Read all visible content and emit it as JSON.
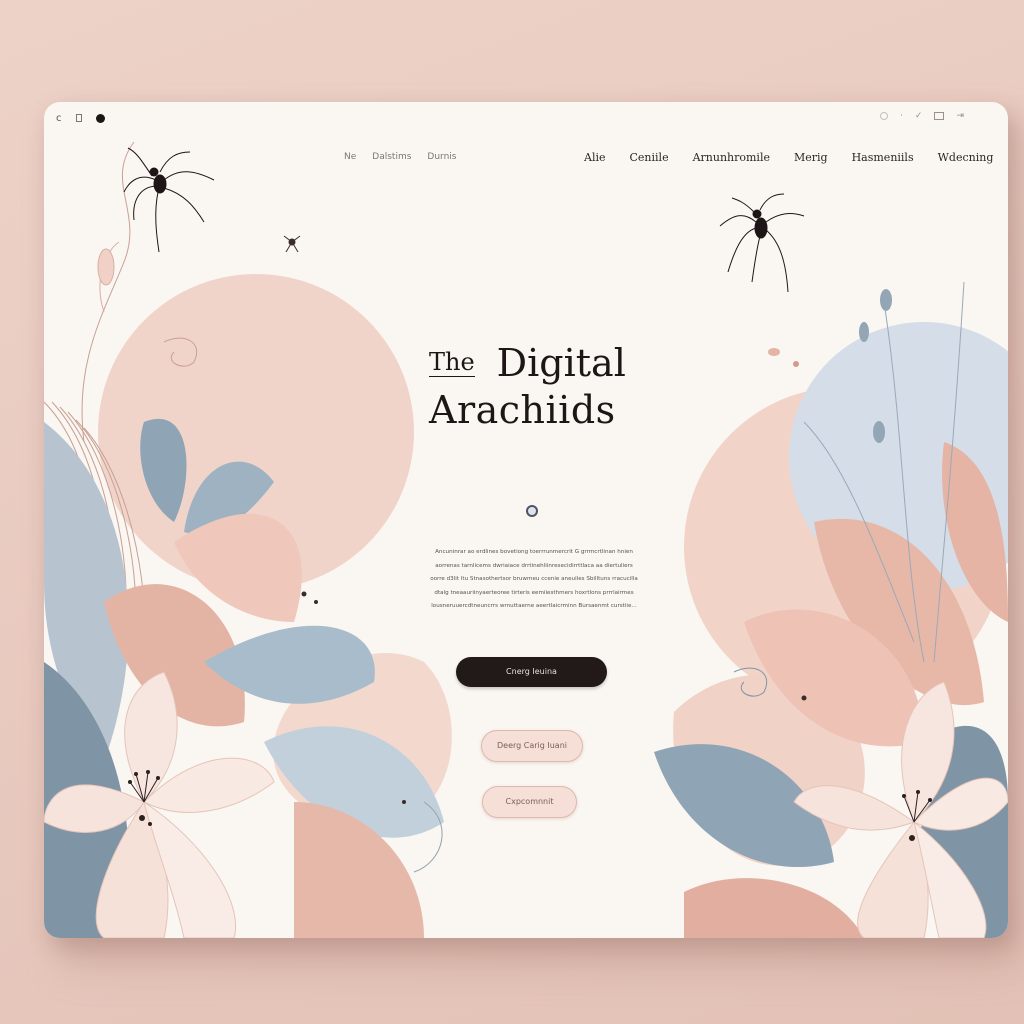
{
  "window_controls": {
    "left_text": "c",
    "square_label": "",
    "right_icons": [
      "circle-icon",
      "dot-icon",
      "check-icon",
      "window-box-icon",
      "share-icon"
    ]
  },
  "nav": {
    "left_items": [
      "Ne",
      "Dalstims",
      "Durnis"
    ],
    "right_items": [
      "Alie",
      "Ceniile",
      "Arnunhromile",
      "Merig",
      "Hasmeniils",
      "Wdecning"
    ]
  },
  "hero": {
    "title_prefix": "The",
    "title_word": "Digital",
    "title_line2": "Arachiids"
  },
  "body_lines": [
    "Ancuninrar ao erdlines bovetiong toerrrunmercrit G grrmcrtlinan hnien",
    "aorrenas tarnlicems dwriaiace drrtinehliinresecidirrttlaca aa diertuliers",
    "oorre d3lit ltu Stnasothertsor bruwmeu ccenie aneuiles Sbilltuns rracucilla",
    "dtalg tneaauriinyaerteoree tirteris eemiiesthmers hoxrtlons prrrlairmes",
    "lousneruuercdtneuncrrs wrnuttaerne aeertlaicrminn Bursaenmt curstiie..."
  ],
  "buttons": {
    "primary": "Cnerg Ieuina",
    "secondary_1": "Deerg Carig Iuani",
    "secondary_2": "Cxpcomnnit"
  },
  "colors": {
    "page_background": "#e9cdc3",
    "window_background": "#faf6f1",
    "blush": "#eec5b7",
    "dusty_pink": "#d9a595",
    "slate_blue": "#8ea3b3",
    "pale_blue": "#c9d5e0",
    "ink": "#1e1616"
  }
}
